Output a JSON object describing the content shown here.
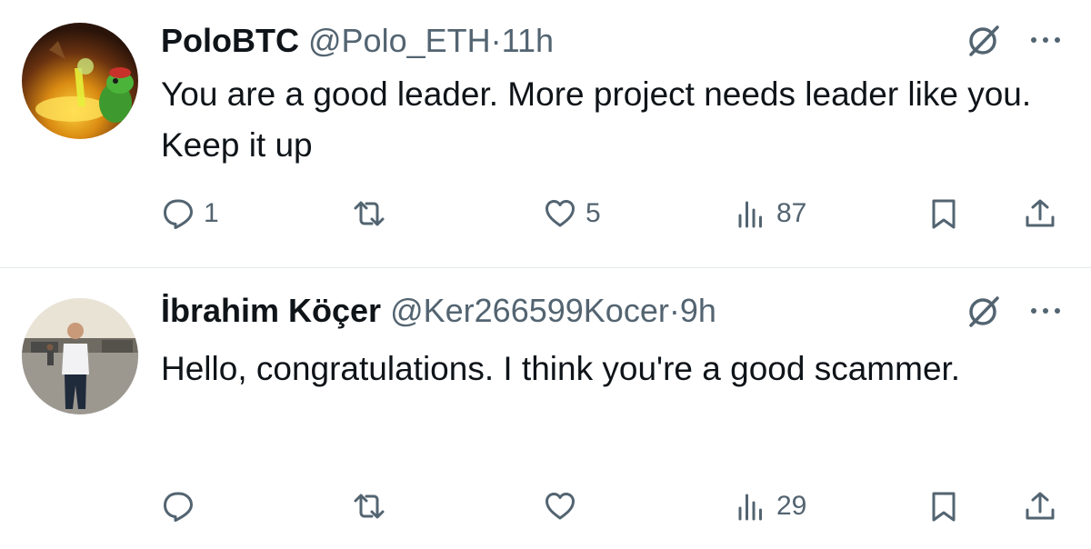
{
  "replies": [
    {
      "display_name": "PoloBTC",
      "handle": "@Polo_ETH",
      "separator": "·",
      "time": "11h",
      "text": "You are a good leader. More project needs leader like you. Keep it up",
      "avatar_icon": "green-frog-avatar",
      "counts": {
        "replies": "1",
        "reposts": "",
        "likes": "5",
        "views": "87"
      }
    },
    {
      "display_name": "İbrahim Köçer",
      "handle": "@Ker266599Kocer",
      "separator": "·",
      "time": "9h",
      "text": "Hello, congratulations. I think you're a good scammer.",
      "avatar_icon": "person-photo-avatar",
      "counts": {
        "replies": "",
        "reposts": "",
        "likes": "",
        "views": "29"
      }
    }
  ],
  "icons": {
    "reply": "reply-icon",
    "repost": "repost-icon",
    "like": "heart-icon",
    "views": "views-icon",
    "bookmark": "bookmark-icon",
    "share": "share-icon",
    "grok": "grok-icon",
    "more": "more-icon"
  },
  "colors": {
    "text": "#0f1419",
    "secondary": "#536471",
    "divider": "#e4e8eb"
  }
}
